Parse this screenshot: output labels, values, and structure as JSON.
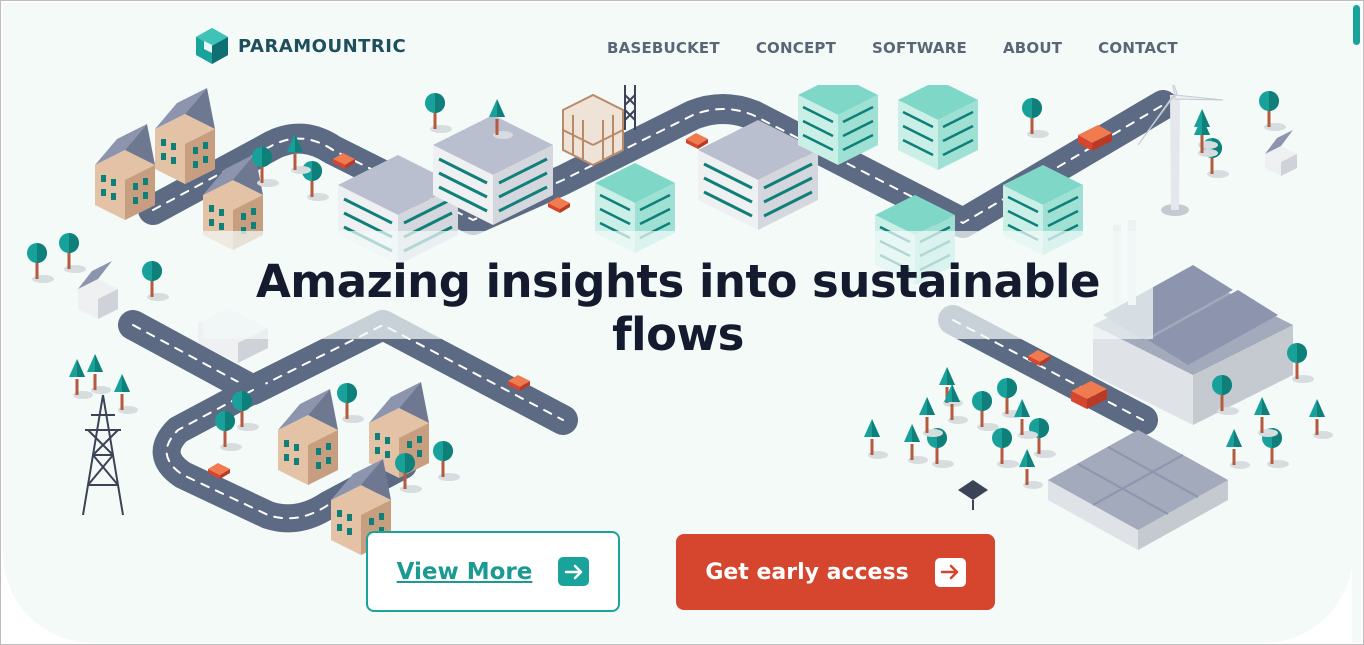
{
  "brand": {
    "name": "PARAMOUNTRIC",
    "logo_icon": "hexagon-cube-icon",
    "color": "#1aa39a"
  },
  "nav": {
    "items": [
      {
        "label": "BASEBUCKET"
      },
      {
        "label": "CONCEPT"
      },
      {
        "label": "SOFTWARE"
      },
      {
        "label": "ABOUT"
      },
      {
        "label": "CONTACT"
      }
    ]
  },
  "hero": {
    "headline": "Amazing insights into sustainable flows",
    "illustration": "isometric-city-illustration",
    "background": "#f3faf8"
  },
  "cta": {
    "view_more": {
      "label": "View More",
      "icon": "arrow-right-icon",
      "color": "#1aa39a"
    },
    "early_access": {
      "label": "Get early access",
      "icon": "arrow-right-icon",
      "color": "#d6452e"
    }
  }
}
